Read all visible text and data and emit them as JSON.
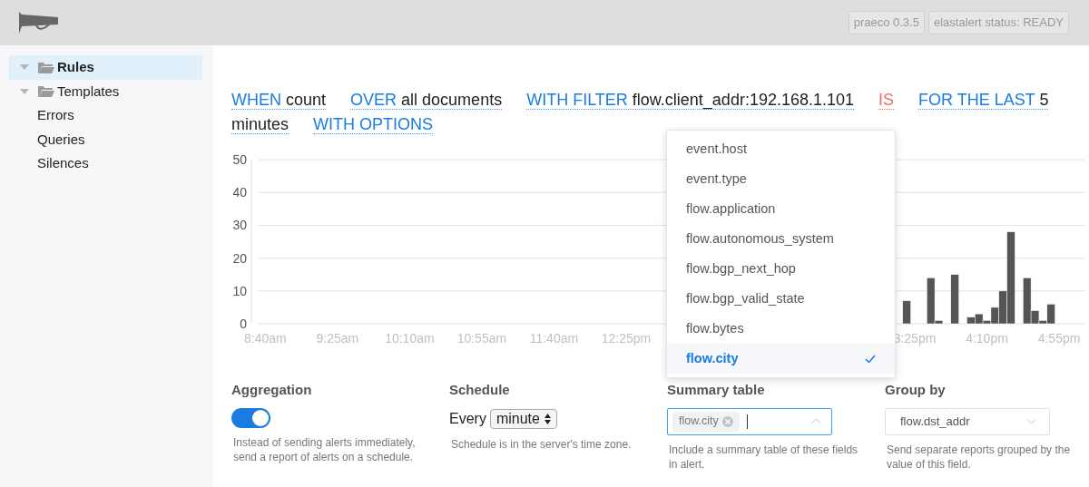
{
  "header": {
    "badges": [
      "praeco 0.3.5",
      "elastalert status: READY"
    ]
  },
  "sidebar": {
    "items": [
      {
        "label": "Rules",
        "kind": "folder",
        "expanded": true,
        "selected": true
      },
      {
        "label": "Templates",
        "kind": "folder",
        "expanded": true,
        "selected": false
      },
      {
        "label": "Errors",
        "kind": "link",
        "selected": false
      },
      {
        "label": "Queries",
        "kind": "link",
        "selected": false
      },
      {
        "label": "Silences",
        "kind": "link",
        "selected": false
      }
    ]
  },
  "rule_sentence": [
    {
      "keyword": "WHEN",
      "value": "count",
      "invalid": false
    },
    {
      "keyword": "OVER",
      "value": "all documents",
      "invalid": false
    },
    {
      "keyword": "WITH FILTER",
      "value": "flow.client_addr:192.168.1.101",
      "invalid": false
    },
    {
      "keyword": "IS",
      "invalid": true
    },
    {
      "keyword": "FOR THE LAST",
      "value": "5 minutes",
      "invalid": false
    },
    {
      "keyword": "WITH OPTIONS",
      "invalid": false
    }
  ],
  "chart_data": {
    "type": "bar",
    "x": [
      917.5,
      932.5,
      937.5,
      947.5,
      957.5,
      962.5,
      967.5,
      972.5,
      977.5,
      982.5,
      992.5,
      997.5,
      1002.5,
      1007.5
    ],
    "series": [
      {
        "color": "#555555",
        "values": [
          7,
          14,
          1,
          15,
          2,
          3,
          1,
          5,
          10,
          28,
          14,
          4,
          1,
          6
        ]
      }
    ],
    "grid": true,
    "xlim": [
      513,
      1028
    ],
    "ylim": [
      0,
      50
    ],
    "yticks": [
      0,
      10,
      20,
      30,
      40,
      50
    ],
    "xticks": [
      {
        "value": 520,
        "label": "8:40am"
      },
      {
        "value": 565,
        "label": "9:25am"
      },
      {
        "value": 610,
        "label": "10:10am"
      },
      {
        "value": 655,
        "label": "10:55am"
      },
      {
        "value": 700,
        "label": "11:40am"
      },
      {
        "value": 745,
        "label": "12:25pm"
      },
      {
        "value": 925,
        "label": "3:25pm"
      },
      {
        "value": 970,
        "label": "4:10pm"
      },
      {
        "value": 1015,
        "label": "4:55pm"
      }
    ]
  },
  "field_dropdown": {
    "options": [
      {
        "label": "event.host",
        "selected": false
      },
      {
        "label": "event.type",
        "selected": false
      },
      {
        "label": "flow.application",
        "selected": false
      },
      {
        "label": "flow.autonomous_system",
        "selected": false
      },
      {
        "label": "flow.bgp_next_hop",
        "selected": false
      },
      {
        "label": "flow.bgp_valid_state",
        "selected": false
      },
      {
        "label": "flow.bytes",
        "selected": false
      },
      {
        "label": "flow.city",
        "selected": true
      }
    ]
  },
  "options": {
    "aggregation": {
      "label": "Aggregation",
      "enabled": true,
      "help": "Instead of sending alerts immediately, send a report of alerts on a schedule."
    },
    "schedule": {
      "label": "Schedule",
      "prefix": "Every",
      "value": "minute",
      "help": "Schedule is in the server's time zone."
    },
    "summary_table": {
      "label": "Summary table",
      "tags": [
        "flow.city"
      ],
      "help": "Include a summary table of these fields in alert."
    },
    "group_by": {
      "label": "Group by",
      "value": "flow.dst_addr",
      "help": "Send separate reports grouped by the value of this field."
    }
  }
}
